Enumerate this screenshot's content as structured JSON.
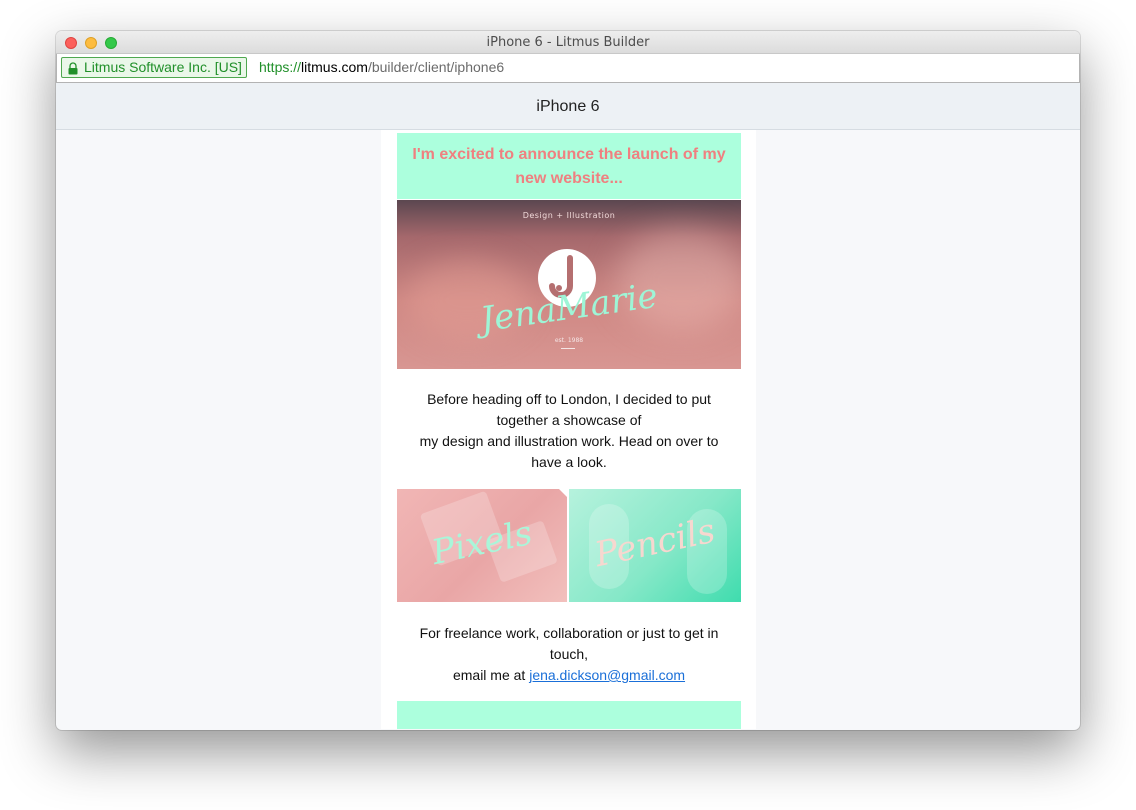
{
  "window": {
    "title": "iPhone 6 - Litmus Builder"
  },
  "address_bar": {
    "certificate": "Litmus Software Inc. [US]",
    "url_scheme": "https://",
    "url_host": "litmus.com",
    "url_path": "/builder/client/iphone6"
  },
  "device_bar": {
    "label": "iPhone 6"
  },
  "email": {
    "headline": "I'm excited to announce the launch of my new website...",
    "hero": {
      "tagline": "Design + Illustration",
      "logo_script": "JenaMarie",
      "est": "est. 1988"
    },
    "intro_line1": "Before heading off to London, I decided to put together a showcase of",
    "intro_line2": "my design and illustration work. Head on over to have a look.",
    "tiles": {
      "pixels_label": "Pixels",
      "pencils_label": "Pencils"
    },
    "contact_line1": "For freelance work, collaboration or just to get in touch,",
    "contact_prefix": "email me at ",
    "contact_email": "jena.dickson@gmail.com"
  },
  "colors": {
    "banner_bg": "#acffdd",
    "headline_text": "#ef8080",
    "link": "#1a6fd8",
    "secure_green": "#21902a"
  }
}
